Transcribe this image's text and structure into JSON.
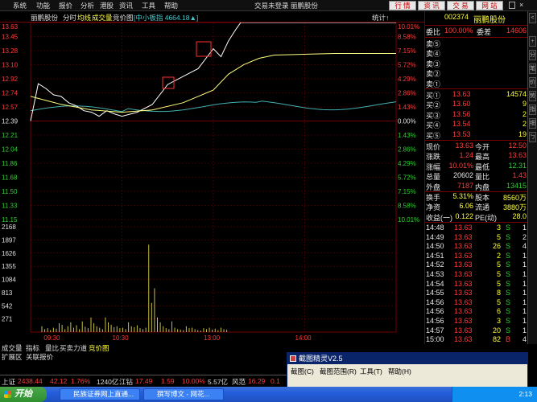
{
  "menu": {
    "items": [
      "系统",
      "功能",
      "报价",
      "分析",
      "港股",
      "资讯",
      "工具",
      "帮助"
    ],
    "title": "交易未登录  丽鹏股份",
    "buttons": [
      "行 情",
      "资 讯",
      "交 易",
      "网 站"
    ]
  },
  "toolbar2": {
    "stock_name": "丽鹏股份",
    "mode": "分时",
    "avg_label": "均线",
    "vol_label": "成交量",
    "auction_label": "竞价图",
    "index_info": "[中小板指 4664.18▲]",
    "stat_label": "统计↑"
  },
  "colors": {
    "up": "#ff3c3c",
    "down": "#2fd02f",
    "price_line": "#ffffff",
    "avg_line": "#ffff80",
    "index_line": "#40b0b0",
    "grid": "#700000"
  },
  "chart_data": {
    "type": "line",
    "price_axis": {
      "prev_close": 12.39,
      "ylim": [
        11.15,
        13.63
      ],
      "left_ticks": [
        "13.63",
        "13.45",
        "13.28",
        "13.10",
        "12.92",
        "12.74",
        "12.57",
        "12.39",
        "12.21",
        "12.04",
        "11.86",
        "11.68",
        "11.50",
        "11.33",
        "11.15"
      ],
      "right_ticks": [
        "10.01%",
        "8.58%",
        "7.15%",
        "5.72%",
        "4.29%",
        "2.86%",
        "1.43%",
        "0.00%",
        "1.43%",
        "2.86%",
        "4.29%",
        "5.72%",
        "7.15%",
        "8.58%",
        "10.01%"
      ]
    },
    "volume_axis": {
      "ylim": [
        0,
        2168
      ],
      "ticks": [
        "2168",
        "1897",
        "1626",
        "1355",
        "1084",
        "813",
        "542",
        "271"
      ]
    },
    "x_ticks": [
      "09:30",
      "10:30",
      "13:00",
      "14:00"
    ],
    "series": [
      {
        "name": "价格",
        "x": [
          0,
          5,
          10,
          15,
          20,
          25,
          30,
          35,
          40,
          45,
          50,
          55,
          60,
          70,
          80,
          90,
          100,
          110,
          120,
          125,
          130,
          135,
          138,
          140,
          145,
          150,
          155,
          160,
          170,
          180,
          200,
          220,
          240
        ],
        "values": [
          12.39,
          12.86,
          12.8,
          12.72,
          12.7,
          12.62,
          12.58,
          12.52,
          12.5,
          12.45,
          12.52,
          12.48,
          12.45,
          12.5,
          12.6,
          12.85,
          12.95,
          13.05,
          13.3,
          13.2,
          13.4,
          13.55,
          13.63,
          13.63,
          13.63,
          13.63,
          13.63,
          13.63,
          13.63,
          13.63,
          13.63,
          13.63,
          13.63
        ]
      },
      {
        "name": "均价",
        "x": [
          0,
          20,
          40,
          60,
          80,
          100,
          110,
          120,
          130,
          140,
          150,
          160,
          180,
          200,
          220,
          240
        ],
        "values": [
          12.7,
          12.6,
          12.53,
          12.5,
          12.53,
          12.62,
          12.7,
          12.78,
          12.98,
          13.1,
          13.18,
          13.22,
          13.23,
          13.24,
          13.24,
          13.24
        ]
      }
    ],
    "volume": [
      120,
      60,
      80,
      40,
      90,
      70,
      180,
      150,
      60,
      120,
      200,
      90,
      140,
      60,
      220,
      110,
      80,
      300,
      180,
      120,
      90,
      60,
      300,
      200,
      150,
      100,
      120,
      80,
      90,
      60,
      200,
      120,
      100,
      140,
      80,
      60,
      90,
      1800,
      600,
      900,
      300,
      200,
      120,
      80,
      60,
      220,
      90,
      60,
      50,
      40,
      120,
      80,
      90,
      60,
      40,
      30,
      80,
      60,
      90,
      50,
      70,
      40,
      90,
      60,
      50
    ]
  },
  "quote": {
    "code": "002374",
    "name": "丽鹏股份",
    "weibi_label": "委比",
    "weibi_val": "100.00%",
    "weicha_label": "委差",
    "weicha_val": "14606",
    "sells": [
      {
        "label": "卖⑤",
        "price": "",
        "vol": ""
      },
      {
        "label": "卖④",
        "price": "",
        "vol": ""
      },
      {
        "label": "卖③",
        "price": "",
        "vol": ""
      },
      {
        "label": "卖②",
        "price": "",
        "vol": ""
      },
      {
        "label": "卖①",
        "price": "",
        "vol": ""
      }
    ],
    "buys": [
      {
        "label": "买①",
        "price": "13.63",
        "vol": "14574"
      },
      {
        "label": "买②",
        "price": "13.60",
        "vol": "9"
      },
      {
        "label": "买③",
        "price": "13.56",
        "vol": "2"
      },
      {
        "label": "买④",
        "price": "13.54",
        "vol": "2"
      },
      {
        "label": "买⑤",
        "price": "13.53",
        "vol": "19"
      }
    ],
    "stats": [
      {
        "l1": "现价",
        "v1": "13.63",
        "l2": "今开",
        "v2": "12.50",
        "c1": "red",
        "c2": "red"
      },
      {
        "l1": "涨跌",
        "v1": "1.24",
        "l2": "最高",
        "v2": "13.63",
        "c1": "red",
        "c2": "red"
      },
      {
        "l1": "涨幅",
        "v1": "10.01%",
        "l2": "最低",
        "v2": "12.31",
        "c1": "red",
        "c2": "grn"
      },
      {
        "l1": "总量",
        "v1": "20602",
        "l2": "量比",
        "v2": "1.43",
        "c1": "wht",
        "c2": "red"
      },
      {
        "l1": "外盘",
        "v1": "7187",
        "l2": "内盘",
        "v2": "13415",
        "c1": "red",
        "c2": "grn"
      }
    ],
    "stats2": [
      {
        "l1": "换手",
        "v1": "5.31%",
        "l2": "股本",
        "v2": "8560万"
      },
      {
        "l1": "净资",
        "v1": "6.06",
        "l2": "流通",
        "v2": "3880万"
      },
      {
        "l1": "收益(一)",
        "v1": "0.122",
        "l2": "PE(动)",
        "v2": "28.0"
      }
    ],
    "ticks": [
      {
        "t": "14:48",
        "p": "13.63",
        "v": "3",
        "d": "S",
        "n": "1"
      },
      {
        "t": "14:49",
        "p": "13.63",
        "v": "5",
        "d": "S",
        "n": "2"
      },
      {
        "t": "14:50",
        "p": "13.63",
        "v": "26",
        "d": "S",
        "n": "4"
      },
      {
        "t": "14:51",
        "p": "13.63",
        "v": "2",
        "d": "S",
        "n": "1"
      },
      {
        "t": "14:52",
        "p": "13.63",
        "v": "5",
        "d": "S",
        "n": "1"
      },
      {
        "t": "14:53",
        "p": "13.63",
        "v": "5",
        "d": "S",
        "n": "1"
      },
      {
        "t": "14:54",
        "p": "13.63",
        "v": "5",
        "d": "S",
        "n": "1"
      },
      {
        "t": "14:55",
        "p": "13.63",
        "v": "8",
        "d": "S",
        "n": "1"
      },
      {
        "t": "14:56",
        "p": "13.63",
        "v": "5",
        "d": "S",
        "n": "1"
      },
      {
        "t": "14:56",
        "p": "13.63",
        "v": "6",
        "d": "S",
        "n": "1"
      },
      {
        "t": "14:56",
        "p": "13.63",
        "v": "3",
        "d": "S",
        "n": "1"
      },
      {
        "t": "14:57",
        "p": "13.63",
        "v": "20",
        "d": "S",
        "n": "1"
      },
      {
        "t": "15:00",
        "p": "13.63",
        "v": "82",
        "d": "B",
        "n": "4"
      }
    ]
  },
  "side_buttons": [
    "<",
    "+",
    "分",
    "笔",
    "价",
    "势",
    "指",
    "细",
    "ㄅ"
  ],
  "bottom_tabs1": [
    "成交量",
    "指标",
    "量比",
    "买卖力道",
    "竞价图"
  ],
  "bottom_tabs2": [
    "扩展区",
    "关联报价"
  ],
  "popup": {
    "title": "截图精灵V2.5",
    "menu": [
      "截图(C)",
      "截图范围(R)",
      "工具(T)",
      "帮助(H)"
    ]
  },
  "status": {
    "index_name": "上证",
    "index_val": "2438.44",
    "chg": "42.12",
    "pct": "1.76%",
    "amount": "1240亿",
    "name2": "江钻",
    "p2": "17.49",
    "c2": "1.59",
    "pct2": "10.00%",
    "amt2": "5.57亿",
    "name3": "风范",
    "p3": "16.29",
    "c3": "0.1"
  },
  "taskbar": {
    "start": "开始",
    "tasks": [
      "民族证券网上直通...",
      "撰写博文 - 网花..."
    ],
    "clock": "2:13"
  }
}
